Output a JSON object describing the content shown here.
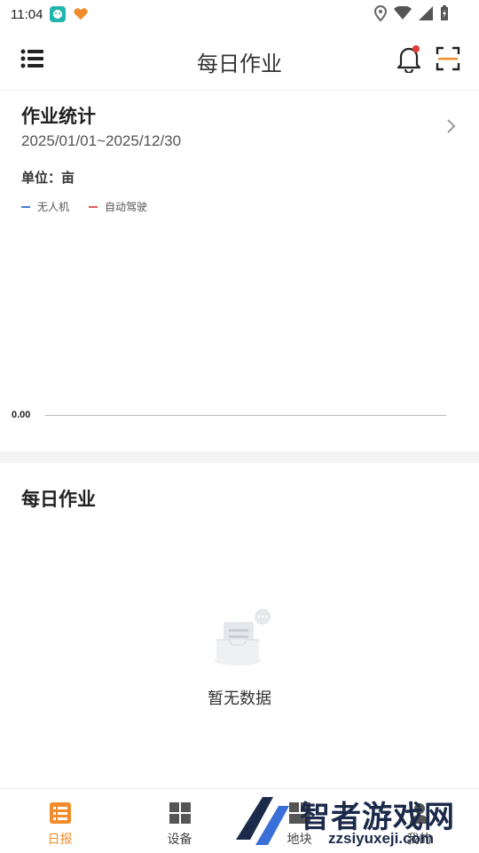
{
  "status_bar": {
    "time": "11:04"
  },
  "header": {
    "title": "每日作业"
  },
  "stats": {
    "title": "作业统计",
    "date_range": "2025/01/01~2025/12/30",
    "unit_label": "单位：亩",
    "legend": [
      {
        "name": "无人机",
        "color": "#4a7bd8"
      },
      {
        "name": "自动驾驶",
        "color": "#e05a5a"
      }
    ],
    "y_tick": "0.00"
  },
  "chart_data": {
    "type": "line",
    "series": [
      {
        "name": "无人机",
        "values": []
      },
      {
        "name": "自动驾驶",
        "values": []
      }
    ],
    "y_ticks": [
      "0.00"
    ],
    "ylabel": "单位：亩"
  },
  "daily": {
    "title": "每日作业",
    "empty_text": "暂无数据"
  },
  "bottom_nav": {
    "items": [
      {
        "label": "日报",
        "icon": "report-list-icon",
        "active": true
      },
      {
        "label": "设备",
        "icon": "grid-icon",
        "active": false
      },
      {
        "label": "地块",
        "icon": "field-icon",
        "active": false
      },
      {
        "label": "我的",
        "icon": "profile-icon",
        "active": false
      }
    ]
  },
  "watermark": {
    "brand": "智者游戏网",
    "url": "zzsiyuxeji.com"
  },
  "colors": {
    "accent": "#f08c2a",
    "notification_dot": "#e53935"
  }
}
